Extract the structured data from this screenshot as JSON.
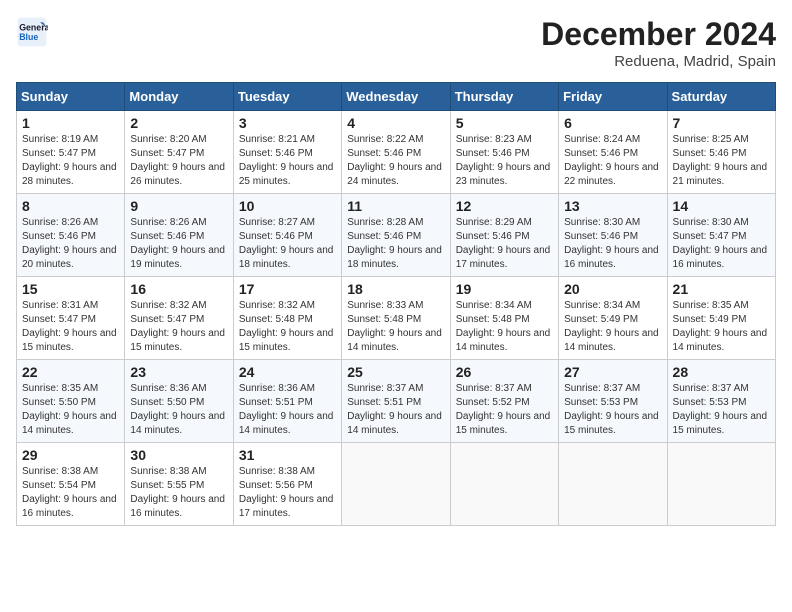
{
  "header": {
    "logo_line1": "General",
    "logo_line2": "Blue",
    "month": "December 2024",
    "location": "Reduena, Madrid, Spain"
  },
  "weekdays": [
    "Sunday",
    "Monday",
    "Tuesday",
    "Wednesday",
    "Thursday",
    "Friday",
    "Saturday"
  ],
  "weeks": [
    [
      {
        "day": "1",
        "sunrise": "8:19 AM",
        "sunset": "5:47 PM",
        "daylight": "9 hours and 28 minutes."
      },
      {
        "day": "2",
        "sunrise": "8:20 AM",
        "sunset": "5:47 PM",
        "daylight": "9 hours and 26 minutes."
      },
      {
        "day": "3",
        "sunrise": "8:21 AM",
        "sunset": "5:46 PM",
        "daylight": "9 hours and 25 minutes."
      },
      {
        "day": "4",
        "sunrise": "8:22 AM",
        "sunset": "5:46 PM",
        "daylight": "9 hours and 24 minutes."
      },
      {
        "day": "5",
        "sunrise": "8:23 AM",
        "sunset": "5:46 PM",
        "daylight": "9 hours and 23 minutes."
      },
      {
        "day": "6",
        "sunrise": "8:24 AM",
        "sunset": "5:46 PM",
        "daylight": "9 hours and 22 minutes."
      },
      {
        "day": "7",
        "sunrise": "8:25 AM",
        "sunset": "5:46 PM",
        "daylight": "9 hours and 21 minutes."
      }
    ],
    [
      {
        "day": "8",
        "sunrise": "8:26 AM",
        "sunset": "5:46 PM",
        "daylight": "9 hours and 20 minutes."
      },
      {
        "day": "9",
        "sunrise": "8:26 AM",
        "sunset": "5:46 PM",
        "daylight": "9 hours and 19 minutes."
      },
      {
        "day": "10",
        "sunrise": "8:27 AM",
        "sunset": "5:46 PM",
        "daylight": "9 hours and 18 minutes."
      },
      {
        "day": "11",
        "sunrise": "8:28 AM",
        "sunset": "5:46 PM",
        "daylight": "9 hours and 18 minutes."
      },
      {
        "day": "12",
        "sunrise": "8:29 AM",
        "sunset": "5:46 PM",
        "daylight": "9 hours and 17 minutes."
      },
      {
        "day": "13",
        "sunrise": "8:30 AM",
        "sunset": "5:46 PM",
        "daylight": "9 hours and 16 minutes."
      },
      {
        "day": "14",
        "sunrise": "8:30 AM",
        "sunset": "5:47 PM",
        "daylight": "9 hours and 16 minutes."
      }
    ],
    [
      {
        "day": "15",
        "sunrise": "8:31 AM",
        "sunset": "5:47 PM",
        "daylight": "9 hours and 15 minutes."
      },
      {
        "day": "16",
        "sunrise": "8:32 AM",
        "sunset": "5:47 PM",
        "daylight": "9 hours and 15 minutes."
      },
      {
        "day": "17",
        "sunrise": "8:32 AM",
        "sunset": "5:48 PM",
        "daylight": "9 hours and 15 minutes."
      },
      {
        "day": "18",
        "sunrise": "8:33 AM",
        "sunset": "5:48 PM",
        "daylight": "9 hours and 14 minutes."
      },
      {
        "day": "19",
        "sunrise": "8:34 AM",
        "sunset": "5:48 PM",
        "daylight": "9 hours and 14 minutes."
      },
      {
        "day": "20",
        "sunrise": "8:34 AM",
        "sunset": "5:49 PM",
        "daylight": "9 hours and 14 minutes."
      },
      {
        "day": "21",
        "sunrise": "8:35 AM",
        "sunset": "5:49 PM",
        "daylight": "9 hours and 14 minutes."
      }
    ],
    [
      {
        "day": "22",
        "sunrise": "8:35 AM",
        "sunset": "5:50 PM",
        "daylight": "9 hours and 14 minutes."
      },
      {
        "day": "23",
        "sunrise": "8:36 AM",
        "sunset": "5:50 PM",
        "daylight": "9 hours and 14 minutes."
      },
      {
        "day": "24",
        "sunrise": "8:36 AM",
        "sunset": "5:51 PM",
        "daylight": "9 hours and 14 minutes."
      },
      {
        "day": "25",
        "sunrise": "8:37 AM",
        "sunset": "5:51 PM",
        "daylight": "9 hours and 14 minutes."
      },
      {
        "day": "26",
        "sunrise": "8:37 AM",
        "sunset": "5:52 PM",
        "daylight": "9 hours and 15 minutes."
      },
      {
        "day": "27",
        "sunrise": "8:37 AM",
        "sunset": "5:53 PM",
        "daylight": "9 hours and 15 minutes."
      },
      {
        "day": "28",
        "sunrise": "8:37 AM",
        "sunset": "5:53 PM",
        "daylight": "9 hours and 15 minutes."
      }
    ],
    [
      {
        "day": "29",
        "sunrise": "8:38 AM",
        "sunset": "5:54 PM",
        "daylight": "9 hours and 16 minutes."
      },
      {
        "day": "30",
        "sunrise": "8:38 AM",
        "sunset": "5:55 PM",
        "daylight": "9 hours and 16 minutes."
      },
      {
        "day": "31",
        "sunrise": "8:38 AM",
        "sunset": "5:56 PM",
        "daylight": "9 hours and 17 minutes."
      },
      null,
      null,
      null,
      null
    ]
  ]
}
